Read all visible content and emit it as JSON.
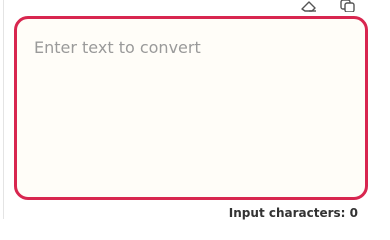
{
  "toolbar": {
    "clear_icon": "eraser-icon",
    "copy_icon": "copy-icon"
  },
  "input": {
    "placeholder": "Enter text to convert",
    "value": ""
  },
  "counter": {
    "label": "Input characters: 0"
  },
  "colors": {
    "accent_border": "#d8264f",
    "textarea_bg": "#fffdf8"
  }
}
